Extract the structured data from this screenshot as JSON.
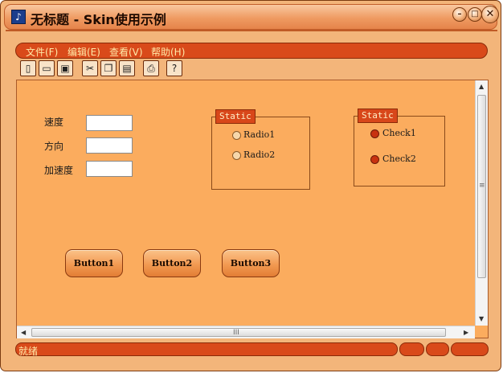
{
  "window": {
    "title": "无标题 - Skin使用示例",
    "app_icon_glyph": "♪"
  },
  "window_buttons": {
    "minimize": "–",
    "maximize": "□",
    "close": "✕"
  },
  "menu": {
    "items": [
      "文件(F)",
      "编辑(E)",
      "查看(V)",
      "帮助(H)"
    ]
  },
  "toolbar": {
    "buttons": [
      {
        "name": "new-file-icon",
        "glyph": "▯"
      },
      {
        "name": "open-folder-icon",
        "glyph": "▭"
      },
      {
        "name": "save-icon",
        "glyph": "▣"
      },
      {
        "name": "cut-icon",
        "glyph": "✂"
      },
      {
        "name": "copy-icon",
        "glyph": "❐"
      },
      {
        "name": "paste-icon",
        "glyph": "▤"
      },
      {
        "name": "print-icon",
        "glyph": "⎙"
      },
      {
        "name": "help-icon",
        "glyph": "?"
      }
    ]
  },
  "form": {
    "fields": [
      {
        "label": "速度",
        "value": ""
      },
      {
        "label": "方向",
        "value": ""
      },
      {
        "label": "加速度",
        "value": ""
      }
    ],
    "radio_group": {
      "caption": "Static",
      "options": [
        "Radio1",
        "Radio2"
      ]
    },
    "check_group": {
      "caption": "Static",
      "options": [
        "Check1",
        "Check2"
      ]
    },
    "buttons": [
      "Button1",
      "Button2",
      "Button3"
    ]
  },
  "scrollbars": {
    "up": "▲",
    "down": "▼",
    "left": "◀",
    "right": "▶",
    "grip_v": "≡",
    "grip_h": "III"
  },
  "status": {
    "text": "就绪"
  },
  "colors": {
    "accent": "#d94a1a",
    "client_bg": "#fbac5e",
    "frame_bg": "#f3b57a",
    "menu_text": "#ffe9a8"
  }
}
